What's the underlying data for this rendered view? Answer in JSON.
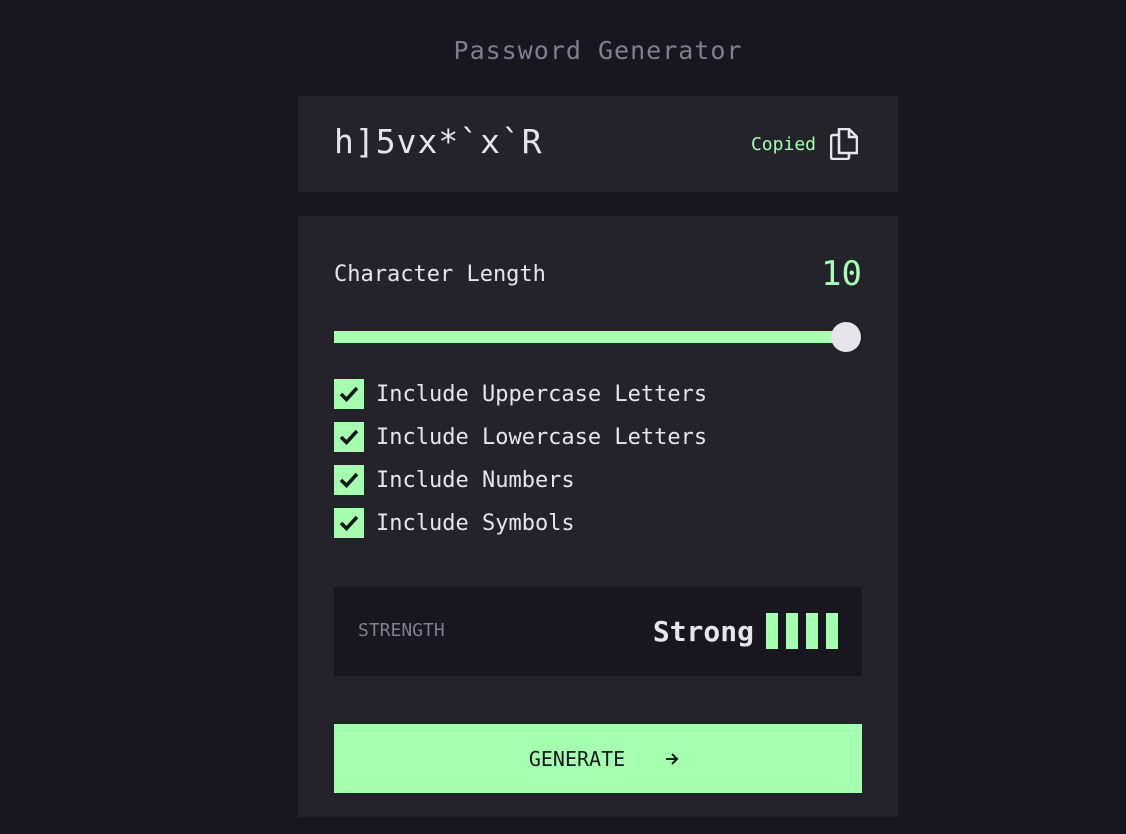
{
  "app": {
    "title": "Password Generator"
  },
  "password": {
    "value": "h]5vx*`x`R",
    "copied_label": "Copied",
    "copy_icon": "copy-icon"
  },
  "length": {
    "label": "Character Length",
    "value": "10",
    "slider_fraction": 0.97
  },
  "options": [
    {
      "label": "Include Uppercase Letters",
      "checked": true
    },
    {
      "label": "Include Lowercase Letters",
      "checked": true
    },
    {
      "label": "Include Numbers",
      "checked": true
    },
    {
      "label": "Include Symbols",
      "checked": true
    }
  ],
  "strength": {
    "label": "STRENGTH",
    "value": "Strong",
    "bars_filled": 4,
    "bars_total": 4
  },
  "generate": {
    "label": "GENERATE",
    "icon": "arrow-right-icon"
  },
  "colors": {
    "background": "#18171f",
    "card": "#24232c",
    "accent": "#a4ffaf",
    "text": "#e6e5ea",
    "muted": "#817d92"
  }
}
